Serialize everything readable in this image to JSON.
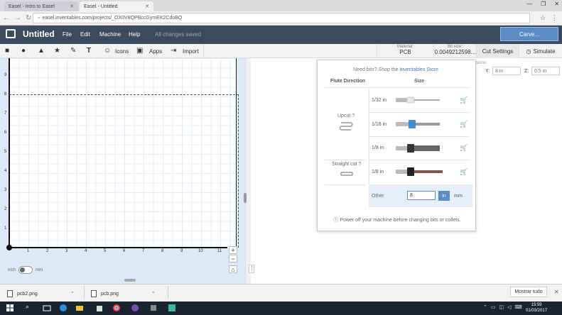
{
  "browser": {
    "tabs": [
      {
        "label": "Easel - Intro to Easel",
        "active": false
      },
      {
        "label": "Easel - Untitled",
        "active": true
      }
    ],
    "url": "easel.inventables.com/projects/_OX0V8QPBccGymEK2CdoBQ"
  },
  "app": {
    "title": "Untitled",
    "menu": [
      "File",
      "Edit",
      "Machine",
      "Help"
    ],
    "save_status": "All changes saved",
    "carve_label": "Carve..."
  },
  "toolbar": {
    "icons_label": "Icons",
    "apps_label": "Apps",
    "import_label": "Import",
    "material_label": "Material:",
    "material_value": "PCB",
    "bit_label": "Bit size:",
    "bit_value": "0.0049212598...",
    "cut_settings": "Cut Settings",
    "simulate": "Simulate"
  },
  "canvas": {
    "y_ticks": [
      "9",
      "8",
      "7",
      "6",
      "5",
      "4",
      "3",
      "2",
      "1"
    ],
    "x_ticks": [
      "1",
      "2",
      "3",
      "4",
      "5",
      "6",
      "7",
      "8",
      "9",
      "10",
      "11"
    ],
    "unit_left": "inch",
    "unit_right": "mm"
  },
  "position": {
    "sions": "sions:",
    "y_label": "Y:",
    "y_placeholder": "8 in",
    "z_label": "Z:",
    "z_placeholder": "0.5 in"
  },
  "bit_popup": {
    "need_bits": "Need bits? Shop the",
    "store_link": "Inventables Store",
    "col_flute": "Flute Direction",
    "col_size": "Size",
    "upcut_label": "Upcut",
    "straight_label": "Straight cut",
    "sizes": [
      "1/32 in",
      "1/16 in",
      "1/8 in",
      "1/8 in"
    ],
    "other_label": "Other",
    "other_value": "8",
    "unit_in": "in",
    "unit_mm": "mm",
    "power_notice": "Power off your machine before changing bits or collets."
  },
  "downloads": {
    "files": [
      "pcb2.png",
      "pcb.png"
    ],
    "show_all": "Mostrar tudo"
  },
  "taskbar": {
    "time": "15:59",
    "date": "01/03/2017"
  },
  "colors": {
    "header": "#3c4a5e",
    "accent": "#5b8cc6",
    "canvas_bg": "#dde9f7",
    "taskbar": "#1a2430"
  }
}
